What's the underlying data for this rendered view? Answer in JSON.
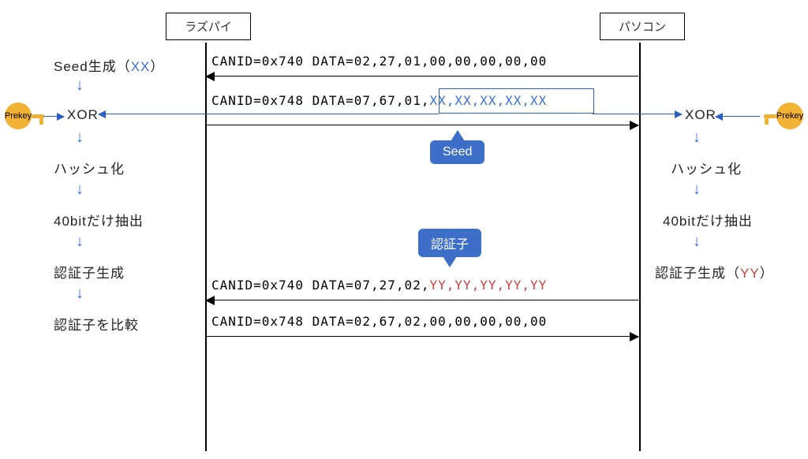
{
  "nodes": {
    "left": "ラズパイ",
    "right": "パソコン"
  },
  "prekey_label": "Prekey",
  "left_steps": {
    "seed_gen_prefix": "Seed生成（",
    "seed_gen_xx": "XX",
    "seed_gen_suffix": "）",
    "xor": "XOR",
    "hash": "ハッシュ化",
    "extract40": "40bitだけ抽出",
    "make_authr": "認証子生成",
    "compare_authr": "認証子を比較"
  },
  "right_steps": {
    "xor": "XOR",
    "hash": "ハッシュ化",
    "extract40": "40bitだけ抽出",
    "make_authr_prefix": "認証子生成（",
    "make_authr_yy": "YY",
    "make_authr_suffix": "）"
  },
  "messages": {
    "m1": "CANID=0x740 DATA=02,27,01,00,00,00,00,00",
    "m2_prefix": "CANID=0x748 DATA=07,67,01,",
    "m2_seed": "XX,XX,XX,XX,XX",
    "m3_prefix": "CANID=0x740 DATA=07,27,02,",
    "m3_auth": "YY,YY,YY,YY,YY",
    "m4": "CANID=0x748 DATA=02,67,02,00,00,00,00,00"
  },
  "callouts": {
    "seed": "Seed",
    "authr": "認証子"
  }
}
